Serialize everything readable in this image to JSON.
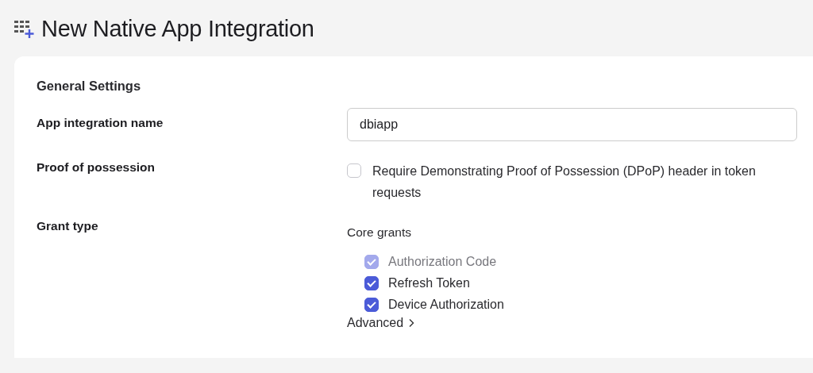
{
  "page": {
    "title": "New Native App Integration"
  },
  "section": {
    "title": "General Settings"
  },
  "fields": [
    {
      "kind": "text",
      "label": "App integration name",
      "value": "dbiapp"
    },
    {
      "kind": "checkbox",
      "label": "Proof of possession",
      "text": "Require Demonstrating Proof of Possession (DPoP) header in token requests",
      "checked": false
    },
    {
      "kind": "grants",
      "label": "Grant type",
      "group": "Core grants",
      "options": [
        {
          "label": "Authorization Code",
          "checked": true,
          "disabled": true
        },
        {
          "label": "Refresh Token",
          "checked": true,
          "disabled": false
        },
        {
          "label": "Device Authorization",
          "checked": true,
          "disabled": false
        }
      ],
      "link": "Advanced"
    }
  ]
}
